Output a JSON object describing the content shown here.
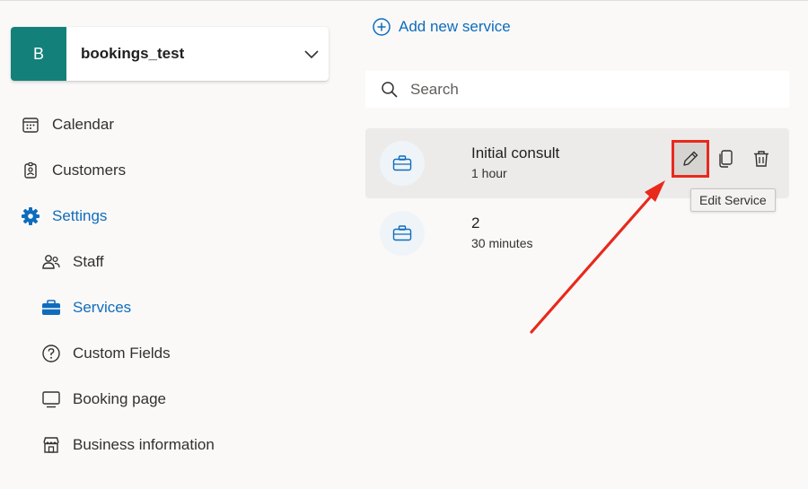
{
  "business": {
    "initial": "B",
    "name": "bookings_test"
  },
  "nav": {
    "calendar": "Calendar",
    "customers": "Customers",
    "settings": "Settings",
    "staff": "Staff",
    "services": "Services",
    "custom_fields": "Custom Fields",
    "booking_page": "Booking page",
    "business_information": "Business information"
  },
  "main": {
    "add_service_label": "Add new service",
    "search_placeholder": "Search",
    "services": [
      {
        "name": "Initial consult",
        "duration": "1 hour"
      },
      {
        "name": "2",
        "duration": "30 minutes"
      }
    ],
    "tooltip": "Edit Service"
  },
  "colors": {
    "accent": "#0f6cbd",
    "avatar": "#14807a",
    "highlight": "#e8291c"
  },
  "icons": [
    "calendar-icon",
    "customers-icon",
    "settings-gear-icon",
    "staff-icon",
    "services-briefcase-icon",
    "custom-fields-help-icon",
    "booking-page-monitor-icon",
    "business-information-store-icon",
    "add-circle-icon",
    "search-icon",
    "edit-pencil-icon",
    "copy-icon",
    "delete-trash-icon",
    "chevron-down-icon"
  ]
}
